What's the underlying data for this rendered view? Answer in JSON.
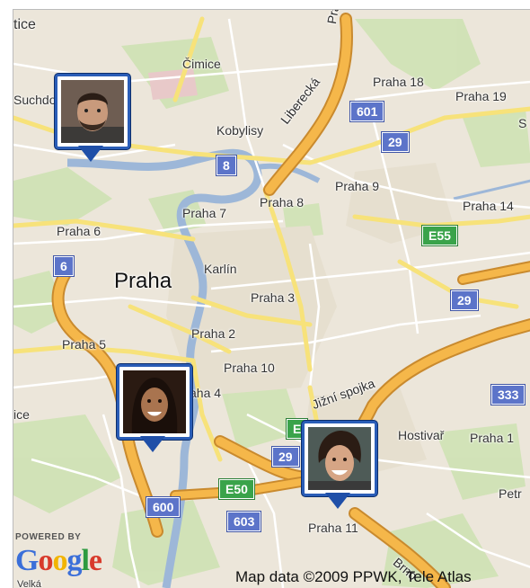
{
  "map": {
    "attribution": "Map data ©2009 PPWK, Tele Atlas",
    "powered_by": "POWERED BY",
    "logo_letters": [
      "G",
      "o",
      "o",
      "g",
      "l",
      "e"
    ],
    "logo_colors": [
      "#3b6fd9",
      "#d83a2b",
      "#f2b400",
      "#3b6fd9",
      "#2d9a3f",
      "#d83a2b"
    ],
    "city": "Praha",
    "places": [
      "tice",
      "Suchdol",
      "Čimice",
      "Praha 18",
      "Praha 19",
      "Kobylisy",
      "Praha 9",
      "Praha 8",
      "Praha 7",
      "Praha 6",
      "Praha 14",
      "Karlín",
      "Praha 3",
      "Praha 2",
      "Praha 5",
      "Praha 10",
      "aha 4",
      "Hostivař",
      "Praha 1",
      "Petr",
      "ice",
      "Praha 11",
      "Velká",
      "S"
    ],
    "roads": [
      "Liberecká",
      "Jižní spojka",
      "Brno",
      "Pražská"
    ],
    "shields_blue": [
      "601",
      "29",
      "8",
      "6",
      "29",
      "333",
      "29",
      "600",
      "603"
    ],
    "shields_green": [
      "E55",
      "E50",
      "E"
    ],
    "markers": [
      {
        "label": "man with short dark hair and beard"
      },
      {
        "label": "woman with long dark hair smiling"
      },
      {
        "label": "woman with short curly hair smiling"
      }
    ]
  }
}
